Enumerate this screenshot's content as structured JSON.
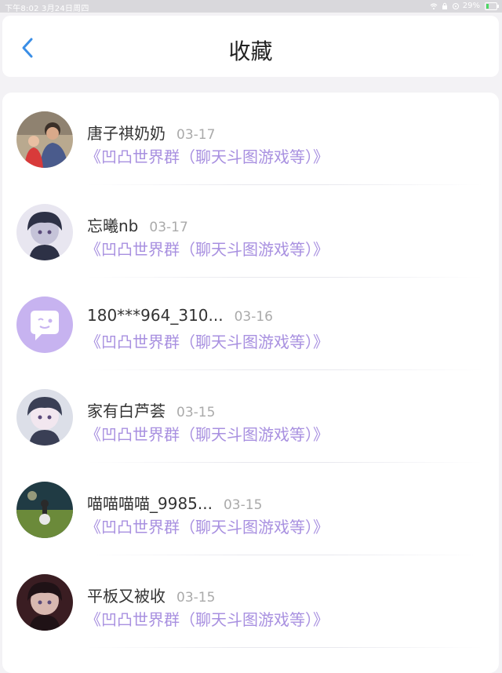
{
  "status_bar": {
    "time_date": "下午8:02   3月24日周四",
    "battery": "29%",
    "battery_level": 0.29
  },
  "navbar": {
    "title": "收藏",
    "back_icon": "chevron-left-icon",
    "accent": "#3a8ee6"
  },
  "favorites": [
    {
      "name": "唐子祺奶奶",
      "date": "03-17",
      "group": "《凹凸世界群（聊天斗图游戏等）》",
      "avatar": "photo-avatar"
    },
    {
      "name": "忘曦nb",
      "date": "03-17",
      "group": "《凹凸世界群（聊天斗图游戏等）》",
      "avatar": "anime-avatar"
    },
    {
      "name": "180***964_310...",
      "date": "03-16",
      "group": "《凹凸世界群（聊天斗图游戏等）》",
      "avatar": "default-chat-avatar"
    },
    {
      "name": "家有白芦荟",
      "date": "03-15",
      "group": "《凹凸世界群（聊天斗图游戏等）》",
      "avatar": "anime-avatar"
    },
    {
      "name": "喵喵喵喵_9985...",
      "date": "03-15",
      "group": "《凹凸世界群（聊天斗图游戏等）》",
      "avatar": "scenery-avatar"
    },
    {
      "name": "平板又被收",
      "date": "03-15",
      "group": "《凹凸世界群（聊天斗图游戏等）》",
      "avatar": "anime-avatar"
    }
  ],
  "colors": {
    "group_text": "#a890e0",
    "default_avatar_bg": "#c7b3f0"
  }
}
